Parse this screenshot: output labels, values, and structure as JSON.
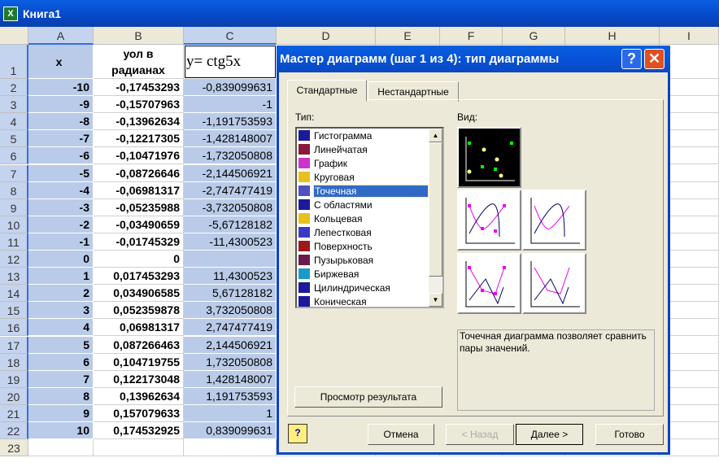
{
  "window": {
    "title": "Книга1",
    "icon": "excel-icon"
  },
  "columns": [
    "A",
    "B",
    "C",
    "D",
    "E",
    "F",
    "G",
    "H",
    "I"
  ],
  "header_row": {
    "row": "1",
    "a": "x",
    "b": "уол в радианах",
    "c": "y=  ctg5x"
  },
  "rows": [
    [
      "2",
      "-10",
      "-0,17453293",
      "-0,839099631"
    ],
    [
      "3",
      "-9",
      "-0,15707963",
      "-1"
    ],
    [
      "4",
      "-8",
      "-0,13962634",
      "-1,191753593"
    ],
    [
      "5",
      "-7",
      "-0,12217305",
      "-1,428148007"
    ],
    [
      "6",
      "-6",
      "-0,10471976",
      "-1,732050808"
    ],
    [
      "7",
      "-5",
      "-0,08726646",
      "-2,144506921"
    ],
    [
      "8",
      "-4",
      "-0,06981317",
      "-2,747477419"
    ],
    [
      "9",
      "-3",
      "-0,05235988",
      "-3,732050808"
    ],
    [
      "10",
      "-2",
      "-0,03490659",
      "-5,67128182"
    ],
    [
      "11",
      "-1",
      "-0,01745329",
      "-11,4300523"
    ],
    [
      "12",
      "0",
      "0",
      ""
    ],
    [
      "13",
      "1",
      "0,017453293",
      "11,4300523"
    ],
    [
      "14",
      "2",
      "0,034906585",
      "5,67128182"
    ],
    [
      "15",
      "3",
      "0,052359878",
      "3,732050808"
    ],
    [
      "16",
      "4",
      "0,06981317",
      "2,747477419"
    ],
    [
      "17",
      "5",
      "0,087266463",
      "2,144506921"
    ],
    [
      "18",
      "6",
      "0,104719755",
      "1,732050808"
    ],
    [
      "19",
      "7",
      "0,122173048",
      "1,428148007"
    ],
    [
      "20",
      "8",
      "0,13962634",
      "1,191753593"
    ],
    [
      "21",
      "9",
      "0,157079633",
      "1"
    ],
    [
      "22",
      "10",
      "0,174532925",
      "0,839099631"
    ],
    [
      "23",
      "",
      "",
      ""
    ]
  ],
  "dialog": {
    "title": "Мастер диаграмм (шаг 1 из 4): тип диаграммы",
    "help": "?",
    "close": "✕",
    "tabs": [
      "Стандартные",
      "Нестандартные"
    ],
    "type_label": "Тип:",
    "view_label": "Вид:",
    "types": [
      {
        "label": "Гистограмма",
        "color": "#1a1a9a"
      },
      {
        "label": "Линейчатая",
        "color": "#8a1a3a"
      },
      {
        "label": "График",
        "color": "#cc33cc"
      },
      {
        "label": "Круговая",
        "color": "#e8c020"
      },
      {
        "label": "Точечная",
        "color": "#5050c0",
        "selected": true
      },
      {
        "label": "С областями",
        "color": "#1a1a9a"
      },
      {
        "label": "Кольцевая",
        "color": "#e8c020"
      },
      {
        "label": "Лепестковая",
        "color": "#3a3ac8"
      },
      {
        "label": "Поверхность",
        "color": "#a01818"
      },
      {
        "label": "Пузырьковая",
        "color": "#6a1a4a"
      },
      {
        "label": "Биржевая",
        "color": "#1a9aca"
      },
      {
        "label": "Цилиндрическая",
        "color": "#1a1a9a"
      },
      {
        "label": "Коническая",
        "color": "#1a1a9a"
      }
    ],
    "preview_button": "Просмотр результата",
    "description": "Точечная диаграмма позволяет сравнить пары значений.",
    "buttons": {
      "cancel": "Отмена",
      "back": "< Назад",
      "next": "Далее >",
      "finish": "Готово"
    }
  }
}
